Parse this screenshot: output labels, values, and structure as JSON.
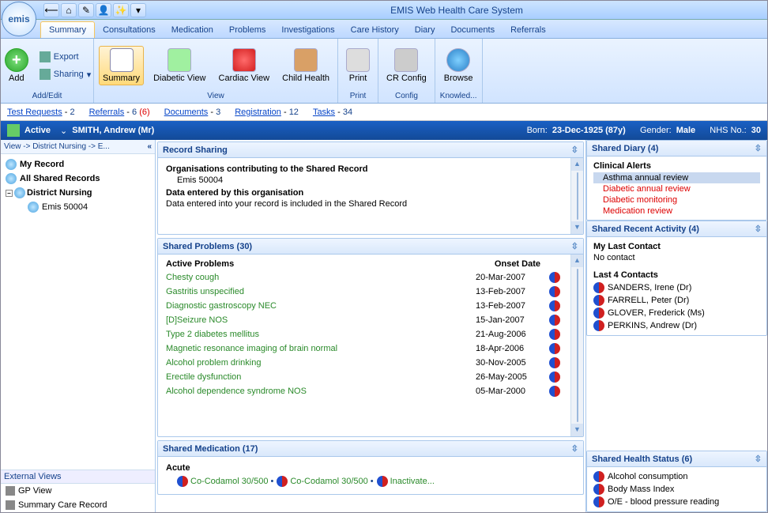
{
  "app_title": "EMIS Web Health Care System",
  "logo_text": "emis",
  "qat": [
    "back-icon",
    "home-icon",
    "edit-icon",
    "user-icon",
    "wand-icon"
  ],
  "tabs": [
    "Summary",
    "Consultations",
    "Medication",
    "Problems",
    "Investigations",
    "Care History",
    "Diary",
    "Documents",
    "Referrals"
  ],
  "active_tab": "Summary",
  "ribbon": {
    "add": {
      "add": "Add",
      "export": "Export",
      "sharing": "Sharing",
      "group": "Add/Edit"
    },
    "view": {
      "summary": "Summary",
      "diabetic": "Diabetic View",
      "cardiac": "Cardiac View",
      "child": "Child Health",
      "group": "View"
    },
    "print": {
      "print": "Print",
      "group": "Print"
    },
    "config": {
      "cr": "CR Config",
      "group": "Config"
    },
    "knowl": {
      "browse": "Browse",
      "group": "Knowled..."
    }
  },
  "linkstrip": [
    {
      "label": "Test Requests",
      "count": "2"
    },
    {
      "label": "Referrals",
      "count": "6",
      "extra": "(6)",
      "extra_red": true
    },
    {
      "label": "Documents",
      "count": "3"
    },
    {
      "label": "Registration",
      "count": "12"
    },
    {
      "label": "Tasks",
      "count": "34"
    }
  ],
  "patient": {
    "status": "Active",
    "name": "SMITH, Andrew (Mr)",
    "born_label": "Born:",
    "born": "23-Dec-1925 (87y)",
    "gender_label": "Gender:",
    "gender": "Male",
    "nhs_label": "NHS No.:",
    "nhs": "30"
  },
  "breadcrumb": "View -> District Nursing -> E...",
  "tree": {
    "my_record": "My Record",
    "all_shared": "All Shared Records",
    "district": "District Nursing",
    "emis": "Emis 50004"
  },
  "external_views": {
    "header": "External Views",
    "gp": "GP View",
    "scr": "Summary Care Record"
  },
  "record_sharing": {
    "title": "Record Sharing",
    "h1": "Organisations contributing to the Shared Record",
    "org": "Emis 50004",
    "h2": "Data entered by this organisation",
    "line": "Data entered into your record is included in the Shared Record"
  },
  "problems": {
    "title": "Shared Problems (30)",
    "h": "Active Problems",
    "col_onset": "Onset Date",
    "rows": [
      {
        "name": "Chesty cough",
        "date": "20-Mar-2007"
      },
      {
        "name": "Gastritis unspecified",
        "date": "13-Feb-2007"
      },
      {
        "name": "Diagnostic gastroscopy NEC",
        "date": "13-Feb-2007"
      },
      {
        "name": "[D]Seizure NOS",
        "date": "15-Jan-2007"
      },
      {
        "name": "Type 2 diabetes mellitus",
        "date": "21-Aug-2006"
      },
      {
        "name": "Magnetic resonance imaging of brain normal",
        "date": "18-Apr-2006"
      },
      {
        "name": "Alcohol problem drinking",
        "date": "30-Nov-2005"
      },
      {
        "name": "Erectile dysfunction",
        "date": "26-May-2005"
      },
      {
        "name": "Alcohol dependence syndrome NOS",
        "date": "05-Mar-2000"
      }
    ]
  },
  "medication": {
    "title": "Shared Medication (17)",
    "h": "Acute",
    "items": [
      "Co-Codamol 30/500",
      "Co-Codamol 30/500",
      "Inactivate..."
    ]
  },
  "diary": {
    "title": "Shared Diary (4)",
    "h": "Clinical Alerts",
    "alerts": [
      {
        "text": "Asthma annual review",
        "sel": true
      },
      {
        "text": "Diabetic annual review",
        "red": true
      },
      {
        "text": "Diabetic monitoring",
        "red": true
      },
      {
        "text": "Medication review",
        "red": true
      }
    ]
  },
  "recent": {
    "title": "Shared Recent Activity (4)",
    "mylast_h": "My Last Contact",
    "mylast": "No contact",
    "last4_h": "Last 4 Contacts",
    "contacts": [
      "SANDERS, Irene (Dr)",
      "FARRELL, Peter (Dr)",
      "GLOVER, Frederick (Ms)",
      "PERKINS, Andrew (Dr)"
    ]
  },
  "health": {
    "title": "Shared Health Status (6)",
    "items": [
      "Alcohol consumption",
      "Body Mass Index",
      "O/E - blood pressure reading"
    ]
  }
}
